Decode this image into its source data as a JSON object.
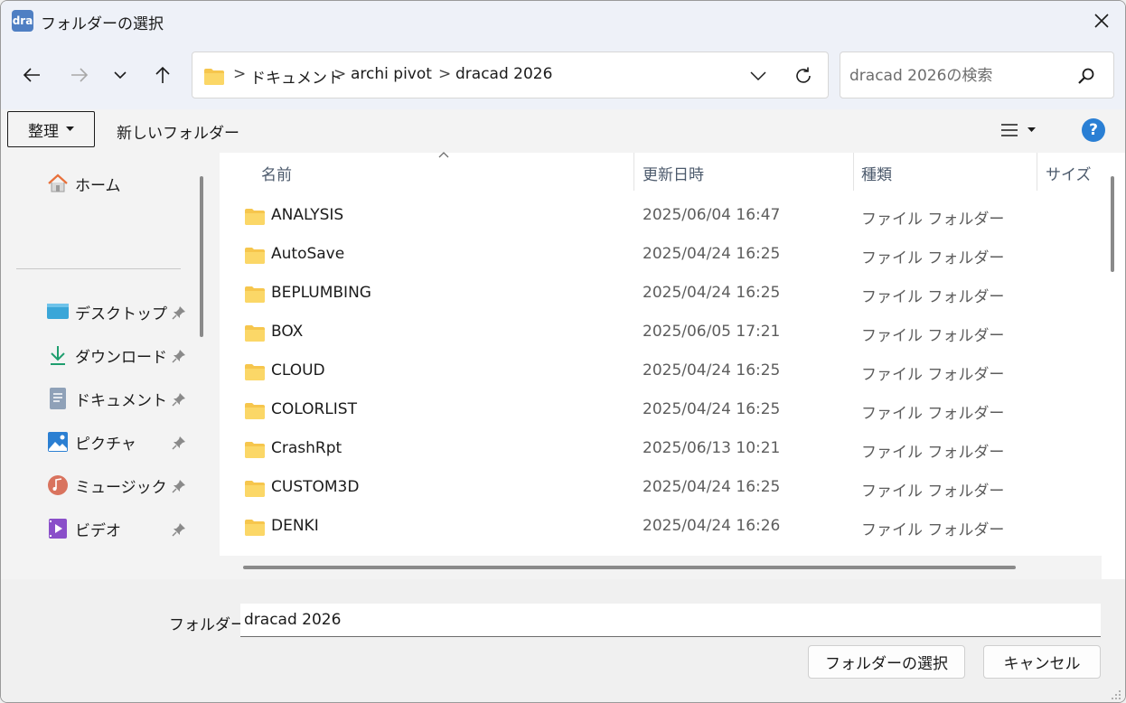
{
  "window": {
    "icon_text": "dra",
    "title": "フォルダーの選択"
  },
  "nav": {
    "breadcrumbs": [
      "ドキュメント",
      "archi pivot",
      "dracad 2026"
    ],
    "separator": ">",
    "search_placeholder": "dracad 2026の検索"
  },
  "toolbar": {
    "organize_label": "整理",
    "new_folder_label": "新しいフォルダー",
    "help_label": "?"
  },
  "sidebar": {
    "home_label": "ホーム",
    "items": [
      {
        "label": "デスクトップ",
        "icon": "desktop-icon"
      },
      {
        "label": "ダウンロード",
        "icon": "download-icon"
      },
      {
        "label": "ドキュメント",
        "icon": "document-icon"
      },
      {
        "label": "ピクチャ",
        "icon": "pictures-icon"
      },
      {
        "label": "ミュージック",
        "icon": "music-icon"
      },
      {
        "label": "ビデオ",
        "icon": "video-icon"
      }
    ]
  },
  "file_list": {
    "columns": [
      "名前",
      "更新日時",
      "種類",
      "サイズ"
    ],
    "rows": [
      {
        "name": "ANALYSIS",
        "date": "2025/06/04 16:47",
        "type": "ファイル フォルダー"
      },
      {
        "name": "AutoSave",
        "date": "2025/04/24 16:25",
        "type": "ファイル フォルダー"
      },
      {
        "name": "BEPLUMBING",
        "date": "2025/04/24 16:25",
        "type": "ファイル フォルダー"
      },
      {
        "name": "BOX",
        "date": "2025/06/05 17:21",
        "type": "ファイル フォルダー"
      },
      {
        "name": "CLOUD",
        "date": "2025/04/24 16:25",
        "type": "ファイル フォルダー"
      },
      {
        "name": "COLORLIST",
        "date": "2025/04/24 16:25",
        "type": "ファイル フォルダー"
      },
      {
        "name": "CrashRpt",
        "date": "2025/06/13 10:21",
        "type": "ファイル フォルダー"
      },
      {
        "name": "CUSTOM3D",
        "date": "2025/04/24 16:25",
        "type": "ファイル フォルダー"
      },
      {
        "name": "DENKI",
        "date": "2025/04/24 16:26",
        "type": "ファイル フォルダー"
      }
    ]
  },
  "footer": {
    "folder_label": "フォルダー:",
    "folder_value": "dracad 2026",
    "select_button": "フォルダーの選択",
    "cancel_button": "キャンセル"
  },
  "colors": {
    "accent": "#2a7fd4",
    "folder": "#f6c64d",
    "titlebar": "#eef1f8"
  }
}
